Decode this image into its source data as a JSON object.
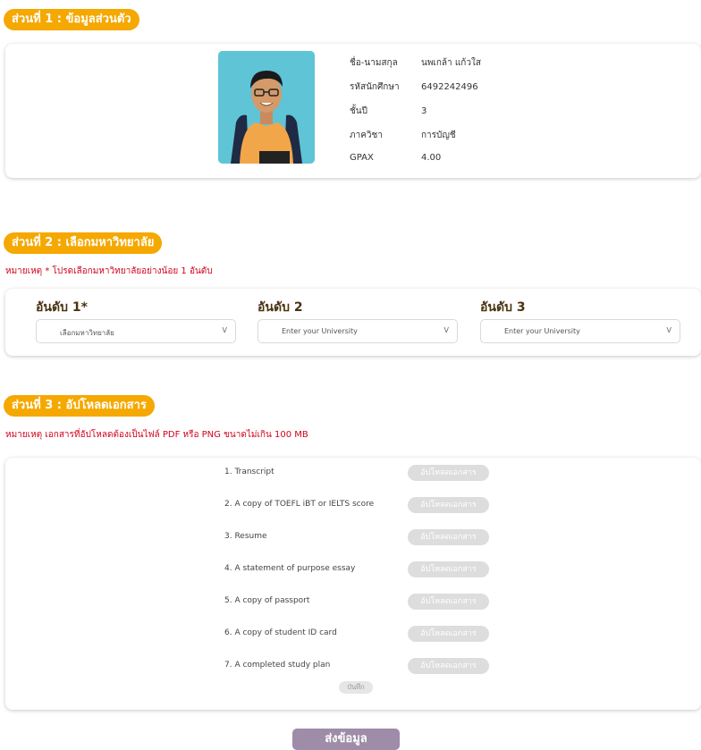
{
  "section1": {
    "title": "ส่วนที่ 1 : ข้อมูลส่วนตัว",
    "photo_alt": "student-photo",
    "fields": [
      {
        "label": "ชื่อ-นามสกุล",
        "value": "นพเกล้า แก้วใส"
      },
      {
        "label": "รหัสนักศึกษา",
        "value": "6492242496"
      },
      {
        "label": "ชั้นปี",
        "value": "3"
      },
      {
        "label": "ภาควิชา",
        "value": "การบัญชี"
      },
      {
        "label": "GPAX",
        "value": "4.00"
      }
    ]
  },
  "section2": {
    "title": "ส่วนที่ 2 : เลือกมหาวิทยาลัย",
    "note": "หมายเหตุ * โปรดเลือกมหาวิทยาลัยอย่างน้อย 1 อันดับ",
    "ranks": [
      {
        "title": "อันดับ 1*",
        "placeholder": "เลือกมหาวิทยาลัย",
        "chevron": "V"
      },
      {
        "title": "อันดับ 2",
        "placeholder": "Enter your University",
        "chevron": "V"
      },
      {
        "title": "อันดับ 3",
        "placeholder": "Enter your University",
        "chevron": "V"
      }
    ]
  },
  "section3": {
    "title": "ส่วนที่ 3 : อัปโหลดเอกสาร",
    "note": "หมายเหตุ เอกสารที่อัปโหลดต้องเป็นไฟล์ PDF หรือ PNG ขนาดไม่เกิน 100 MB",
    "upload_label": "อัปโหลดเอกสาร",
    "documents": [
      "1. Transcript",
      "2. A copy of TOEFL iBT or IELTS score",
      "3. Resume",
      "4. A statement of purpose essay",
      "5. A copy of passport",
      "6. A copy of student ID card",
      "7. A completed study plan"
    ],
    "save_label": "บันทึก"
  },
  "submit_label": "ส่งข้อมูล",
  "colors": {
    "accent": "#f5a800",
    "note": "#d0021b",
    "submit": "#9e8ca8",
    "upload_button": "#dddddd"
  }
}
